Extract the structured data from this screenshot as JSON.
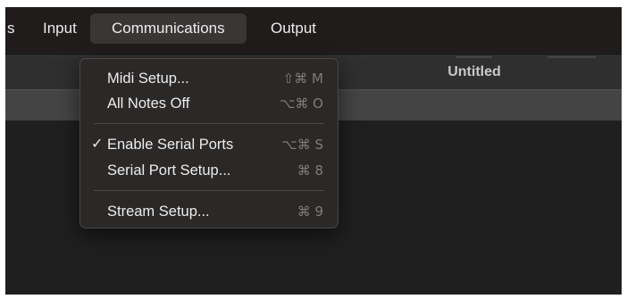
{
  "menubar": {
    "items": [
      {
        "label": "s"
      },
      {
        "label": "Input"
      },
      {
        "label": "Communications"
      },
      {
        "label": "Output"
      }
    ]
  },
  "window": {
    "title": "Untitled"
  },
  "communications_menu": {
    "items": [
      {
        "label": "Midi Setup...",
        "shortcut": "⇧⌘ M",
        "checked": false
      },
      {
        "label": "All Notes Off",
        "shortcut": "⌥⌘ O",
        "checked": false
      },
      {
        "label": "Enable Serial Ports",
        "shortcut": "⌥⌘ S",
        "checked": true,
        "check_glyph": "✓"
      },
      {
        "label": "Serial Port Setup...",
        "shortcut": "⌘ 8",
        "checked": false
      },
      {
        "label": "Stream Setup...",
        "shortcut": "⌘ 9",
        "checked": false
      }
    ]
  },
  "colors": {
    "menubar_bg": "#1f1c1b",
    "menu_bg": "#2b2928",
    "active_menubar_item": "#3a3635",
    "shortcut_text": "#7f7c7a"
  }
}
